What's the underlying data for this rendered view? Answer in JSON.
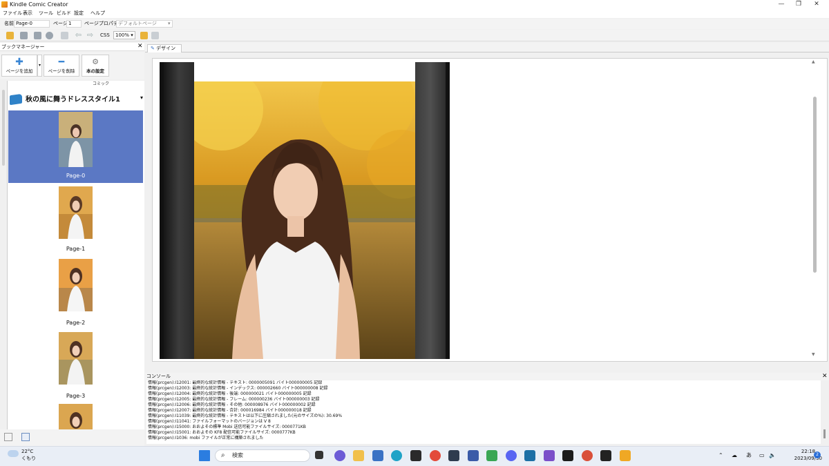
{
  "window": {
    "title": "Kindle Comic Creator"
  },
  "menu": [
    "ファイル",
    "表示",
    "ツール",
    "ビルド",
    "設定",
    "ヘルプ"
  ],
  "props": {
    "name_label": "名前",
    "name_value": "Page-0",
    "page_label": "ページ",
    "page_value": "1",
    "page_prop_label": "ページプロパティ",
    "page_prop_value": "デフォルトページ"
  },
  "toolbar": {
    "css_label": "CSS",
    "zoom": "100%"
  },
  "book_manager": {
    "title": "ブックマネージャー",
    "add_page": "ページを追加",
    "delete_page": "ページを削除",
    "book_settings": "本の設定",
    "column_label": "コミック",
    "book_title": "秋の風に舞うドレススタイル1",
    "pages": [
      "Page-0",
      "Page-1",
      "Page-2",
      "Page-3"
    ]
  },
  "design": {
    "tab": "デザイン"
  },
  "console": {
    "title": "コンソール",
    "lines": [
      "情報(prcgen):I12001: 最終的な統計情報 - テキスト:   0000005091 バイト000000005 記録",
      "情報(prcgen):I12003: 最終的な統計情報 - インデックス:  000002660 バイト000000008 記録",
      "情報(prcgen):I12004: 最終的な統計情報 - 後端:  000000021 バイト000000005 記録",
      "情報(prcgen):I12005: 最終的な統計情報 - フレーム:   000000236 バイト000000003 記録",
      "情報(prcgen):I12006: 最終的な統計情報 - その他:   000008976 バイト000000002 記録",
      "情報(prcgen):I12007: 最終的な統計情報 - 合計:   000016984 バイト000000018 記録",
      "情報(prcgen):I11039: 最終的な統計情報 - テキストは以下に圧縮されました(元のサイズの%):  30.69%",
      "情報(prcgen):I11041: ファイルフォーマットのバージョンは V 8",
      "情報(prcgen):I15000: おおよその標準 Mobi 送信可能ファイルサイズ:  0000771KB",
      "情報(prcgen):I15001: おおよその KF8 配信可能ファイルサイズ:  0000777KB",
      "情報(prcgen):I1036: mobi ファイルが正常に構築されました"
    ]
  },
  "taskbar": {
    "weather_temp": "22°C",
    "weather_desc": "くもり",
    "search_placeholder": "検索",
    "time": "22:18",
    "date": "2023/09/30",
    "ime": "あ",
    "notifications": "2"
  }
}
